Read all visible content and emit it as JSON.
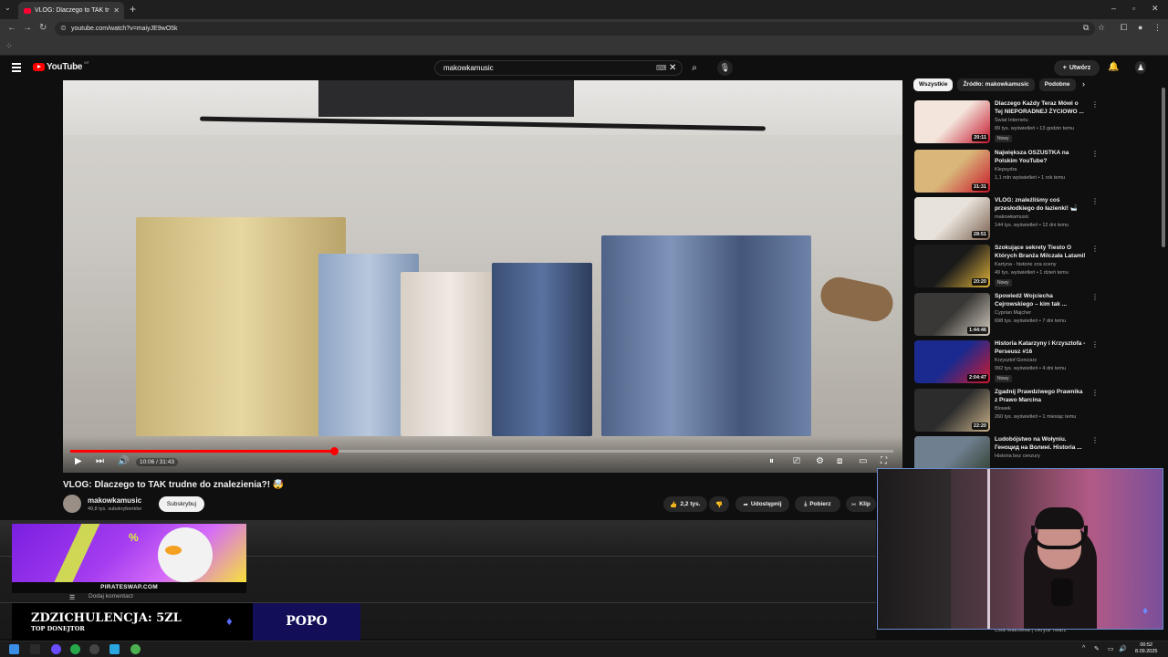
{
  "browser": {
    "tab_title": "VLOG: Dlaczego to TAK trudne",
    "url": "youtube.com/watch?v=maiyJE9wO5k"
  },
  "header": {
    "logo_text": "YouTube",
    "country_code": "MT",
    "search_query": "makowkamusic",
    "create_label": "Utwórz"
  },
  "player": {
    "time": "10:06 / 31:43",
    "progress": 0.32
  },
  "video": {
    "title": "VLOG: Dlaczego to TAK trudne do znalezienia?! 🤯",
    "channel_name": "makowkamusic",
    "subscribers": "49,8 tys. subskrybentów",
    "subscribe_label": "Subskrybuj",
    "likes": "2,2 tys.",
    "share_label": "Udostępnij",
    "download_label": "Pobierz",
    "clip_label": "Klip"
  },
  "comments": {
    "add_placeholder": "Dodaj komentarz"
  },
  "overlay": {
    "ad_site": "PIRATESWAP.COM",
    "donation_main": "ZDZICHULENCJA: 5ZL",
    "donation_sub": "TOP DONEJTOR",
    "popo_label": "POPO"
  },
  "sidebar": {
    "chips": [
      "Wszystkie",
      "Źródło: makowkamusic",
      "Podobne"
    ],
    "items": [
      {
        "title": "Dlaczego Każdy Teraz Mówi o Tej NIEPORADNEJ ŻYCIOWO ...",
        "channel": "Świat Internetu",
        "meta": "89 tys. wyświetleń • 13 godzin temu",
        "badge": "Nowy",
        "duration": "20:11",
        "c1": "#f3e5dc",
        "c2": "#c4152a"
      },
      {
        "title": "Największa OSZUSTKA na Polskim YouTube?",
        "channel": "Klepsydra",
        "meta": "1,1 mln wyświetleń • 1 rok temu",
        "badge": "",
        "duration": "31:31",
        "c1": "#d9b67a",
        "c2": "#c8182a"
      },
      {
        "title": "VLOG: znaleźliśmy coś przesłodkiego do łazienki! 🛁",
        "channel": "makowkamusic",
        "meta": "144 tys. wyświetleń • 12 dni temu",
        "badge": "",
        "duration": "28:51",
        "c1": "#e7e2da",
        "c2": "#7a5f4f"
      },
      {
        "title": "Szokujące sekrety Tiesto O Których Branża Milczała Latami!",
        "channel": "Kartyna - historie zza sceny",
        "meta": "49 tys. wyświetleń • 1 dzień temu",
        "badge": "Nowy",
        "duration": "20:20",
        "c1": "#1a1a1a",
        "c2": "#e1b43a"
      },
      {
        "title": "Spowiedź Wojciecha Cejrowskiego – kim tak ...",
        "channel": "Cyprian Majcher",
        "meta": "698 tys. wyświetleń • 7 dni temu",
        "badge": "",
        "duration": "1:44:46",
        "c1": "#3a3836",
        "c2": "#d4ccc0"
      },
      {
        "title": "Historia Katarzyny i Krzysztofa - Perseusz #16",
        "channel": "Krzysztof Gonciarz",
        "meta": "992 tys. wyświetleń • 4 dni temu",
        "badge": "Nowy",
        "duration": "2:04:47",
        "c1": "#1b2a8f",
        "c2": "#d0192c"
      },
      {
        "title": "Zgadnij Prawdziwego Prawnika z Prawo Marcina",
        "channel": "Blowek",
        "meta": "260 tys. wyświetleń • 1 miesiąc temu",
        "badge": "",
        "duration": "22:20",
        "c1": "#2c2c2c",
        "c2": "#c9b28a"
      },
      {
        "title": "Ludobójstwo na Wołyniu. Геноцид на Волині. Historia ...",
        "channel": "Historia bez cenzury",
        "meta": "",
        "badge": "",
        "duration": "",
        "c1": "#6f7f8f",
        "c2": "#2e3b2a"
      }
    ],
    "last_channel": "Ewa Makówka | Ukryta Twarz"
  },
  "taskbar": {
    "time": "00:52",
    "date": "8.09.2025"
  }
}
